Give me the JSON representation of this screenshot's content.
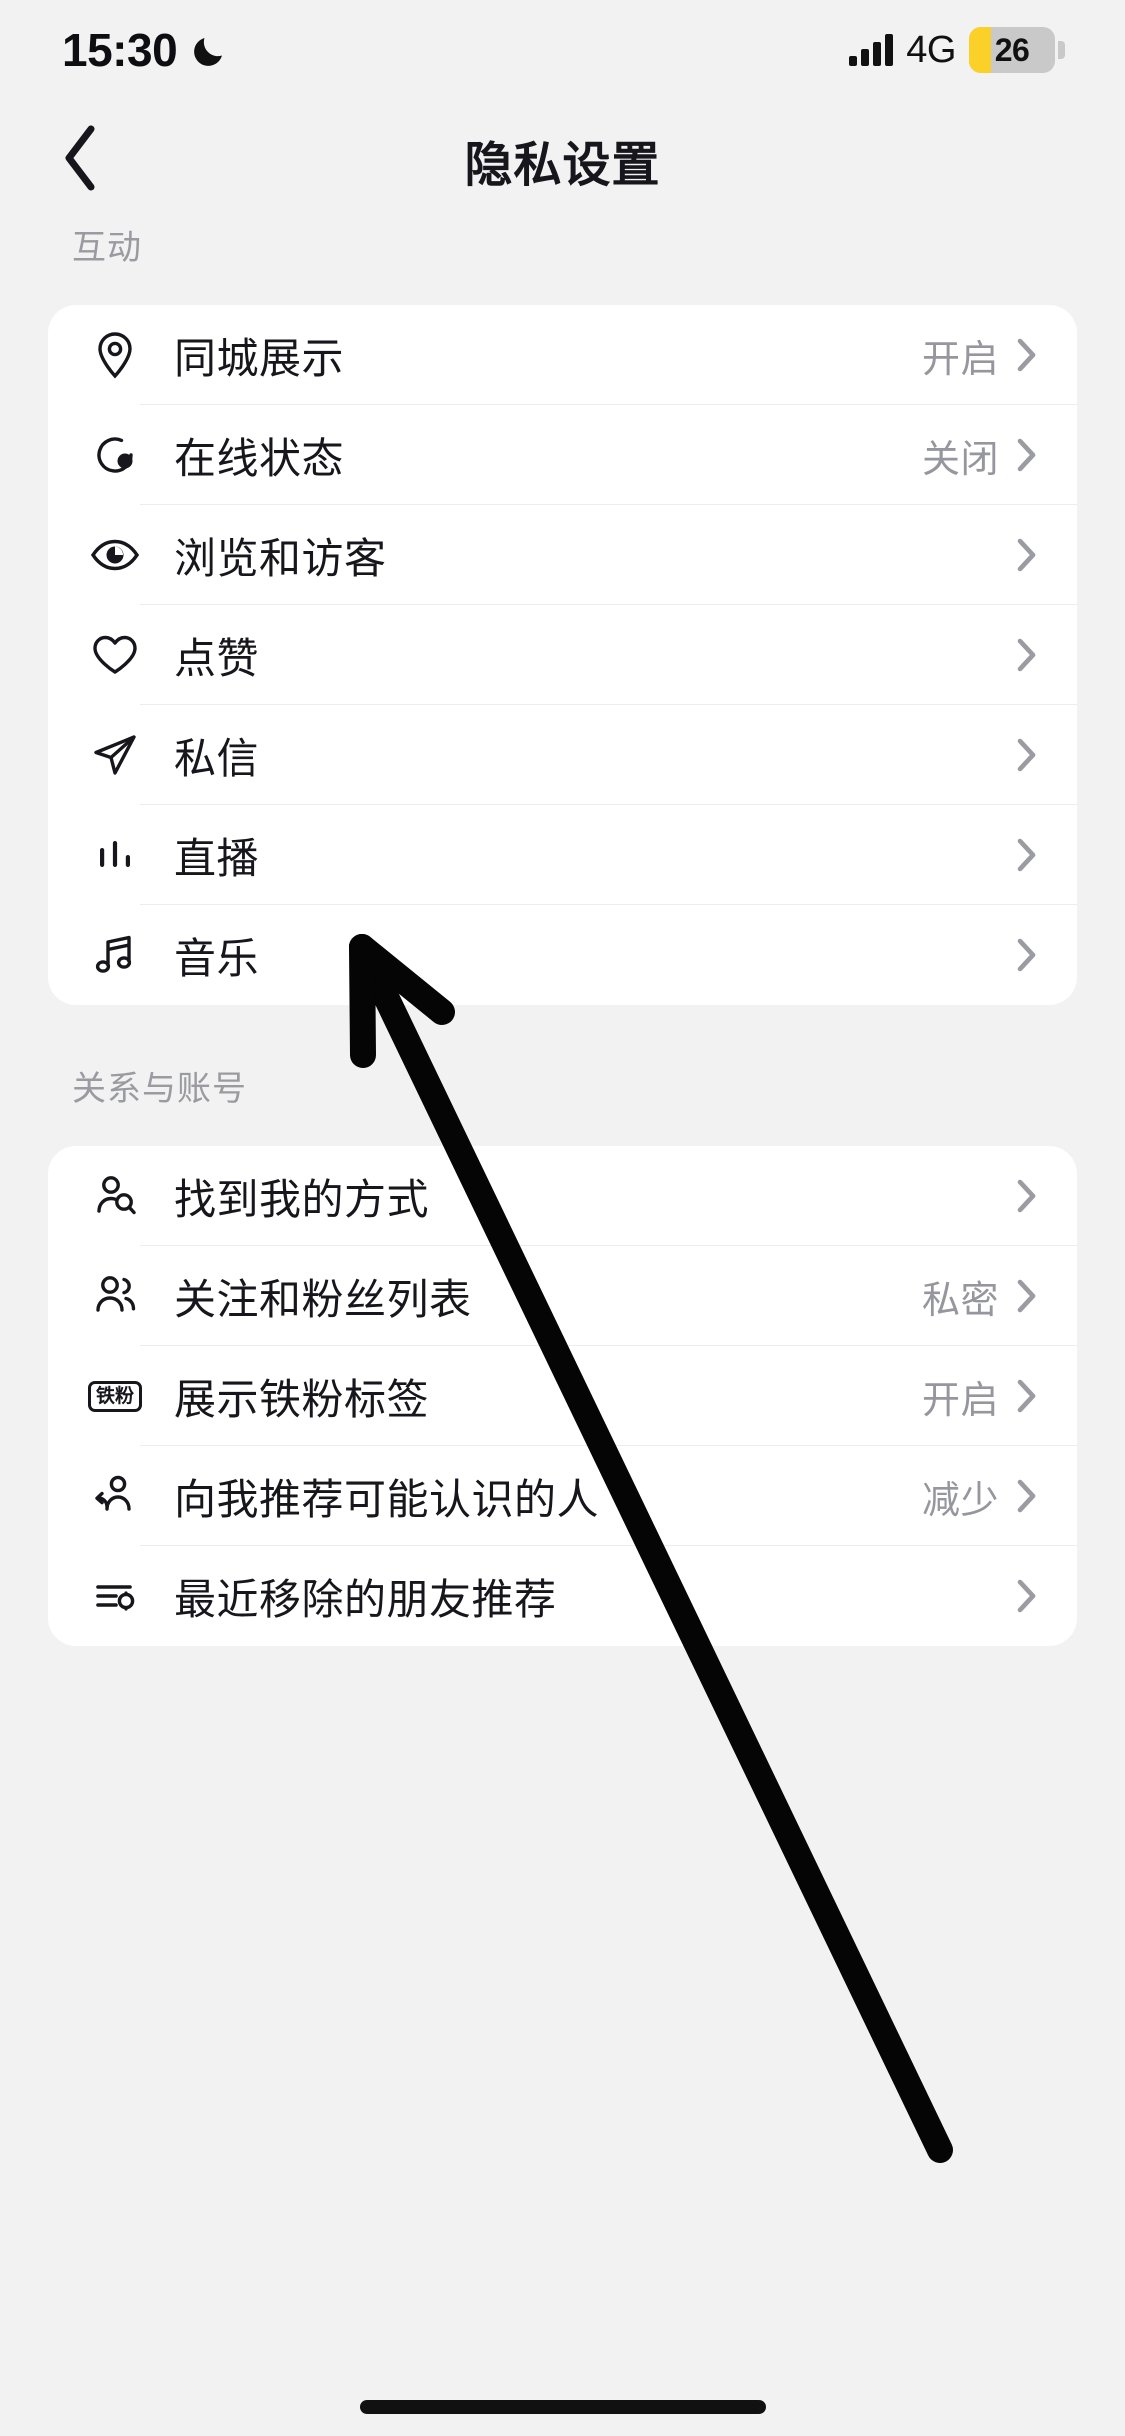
{
  "status_bar": {
    "time": "15:30",
    "dnd_icon": "crescent-moon-icon",
    "network": "4G",
    "battery_percent": "26",
    "signal_icon": "signal-bars-icon"
  },
  "header": {
    "title": "隐私设置",
    "back_icon": "chevron-left-icon"
  },
  "sections": [
    {
      "title": "互动",
      "rows": [
        {
          "icon": "location-pin-icon",
          "label": "同城展示",
          "value": "开启"
        },
        {
          "icon": "online-status-icon",
          "label": "在线状态",
          "value": "关闭"
        },
        {
          "icon": "eye-icon",
          "label": "浏览和访客",
          "value": ""
        },
        {
          "icon": "heart-icon",
          "label": "点赞",
          "value": ""
        },
        {
          "icon": "paper-plane-icon",
          "label": "私信",
          "value": ""
        },
        {
          "icon": "equalizer-icon",
          "label": "直播",
          "value": ""
        },
        {
          "icon": "music-note-icon",
          "label": "音乐",
          "value": ""
        }
      ]
    },
    {
      "title": "关系与账号",
      "rows": [
        {
          "icon": "person-search-icon",
          "label": "找到我的方式",
          "value": ""
        },
        {
          "icon": "two-people-icon",
          "label": "关注和粉丝列表",
          "value": "私密"
        },
        {
          "icon": "iron-fan-badge-icon",
          "label": "展示铁粉标签",
          "value": "开启",
          "badge_text": "铁粉"
        },
        {
          "icon": "person-recommend-icon",
          "label": "向我推荐可能认识的人",
          "value": "减少"
        },
        {
          "icon": "list-settings-icon",
          "label": "最近移除的朋友推荐",
          "value": ""
        }
      ]
    }
  ],
  "annotation": {
    "type": "arrow",
    "description": "black hand-drawn arrow pointing from 减少 value up to 点赞 row"
  },
  "colors": {
    "background": "#f2f2f2",
    "card": "#ffffff",
    "primary_text": "#16161c",
    "secondary_text": "#96969e",
    "section_title": "#9a9aa1",
    "divider": "#ededf0",
    "battery_yellow": "#fbd029",
    "battery_track": "#c9c9c9"
  }
}
